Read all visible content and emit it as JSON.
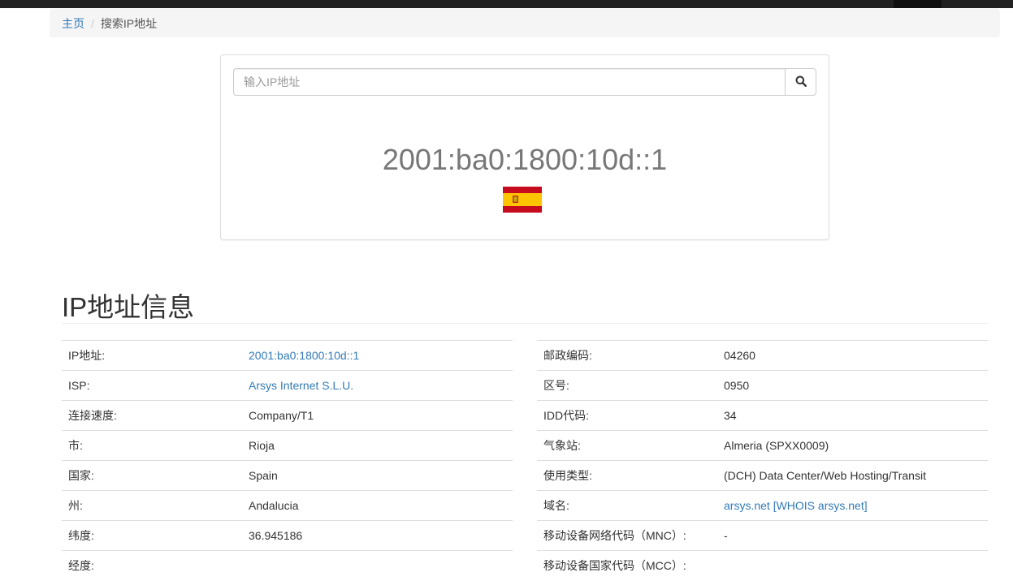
{
  "breadcrumb": {
    "home": "主页",
    "separator": "/",
    "current": "搜索IP地址"
  },
  "search": {
    "placeholder": "输入IP地址",
    "icon": "search-icon"
  },
  "result": {
    "ip": "2001:ba0:1800:10d::1",
    "flag": "spain-flag"
  },
  "section_title": "IP地址信息",
  "left_rows": [
    {
      "label": "IP地址:",
      "value": "2001:ba0:1800:10d::1",
      "link": true
    },
    {
      "label": "ISP:",
      "value": "Arsys Internet S.L.U.",
      "link": true
    },
    {
      "label": "连接速度:",
      "value": "Company/T1",
      "link": false
    },
    {
      "label": "市:",
      "value": "Rioja",
      "link": false
    },
    {
      "label": "国家:",
      "value": "Spain",
      "link": false
    },
    {
      "label": "州:",
      "value": "Andalucia",
      "link": false
    },
    {
      "label": "纬度:",
      "value": "36.945186",
      "link": false
    },
    {
      "label": "经度:",
      "value": "",
      "link": false
    }
  ],
  "right_rows": [
    {
      "label": "邮政编码:",
      "value": "04260",
      "link": false
    },
    {
      "label": "区号:",
      "value": "0950",
      "link": false
    },
    {
      "label": "IDD代码:",
      "value": "34",
      "link": false
    },
    {
      "label": "气象站:",
      "value": "Almeria (SPXX0009)",
      "link": false
    },
    {
      "label": "使用类型:",
      "value": "(DCH) Data Center/Web Hosting/Transit",
      "link": false
    },
    {
      "label": "域名:",
      "value": "arsys.net [WHOIS arsys.net]",
      "link": true
    },
    {
      "label": "移动设备网络代码（MNC）:",
      "value": "-",
      "link": false
    },
    {
      "label": "移动设备国家代码（MCC）:",
      "value": "",
      "link": false
    }
  ],
  "colors": {
    "link": "#337ab7",
    "flag_red": "#c60b1e",
    "flag_yellow": "#ffc400"
  }
}
